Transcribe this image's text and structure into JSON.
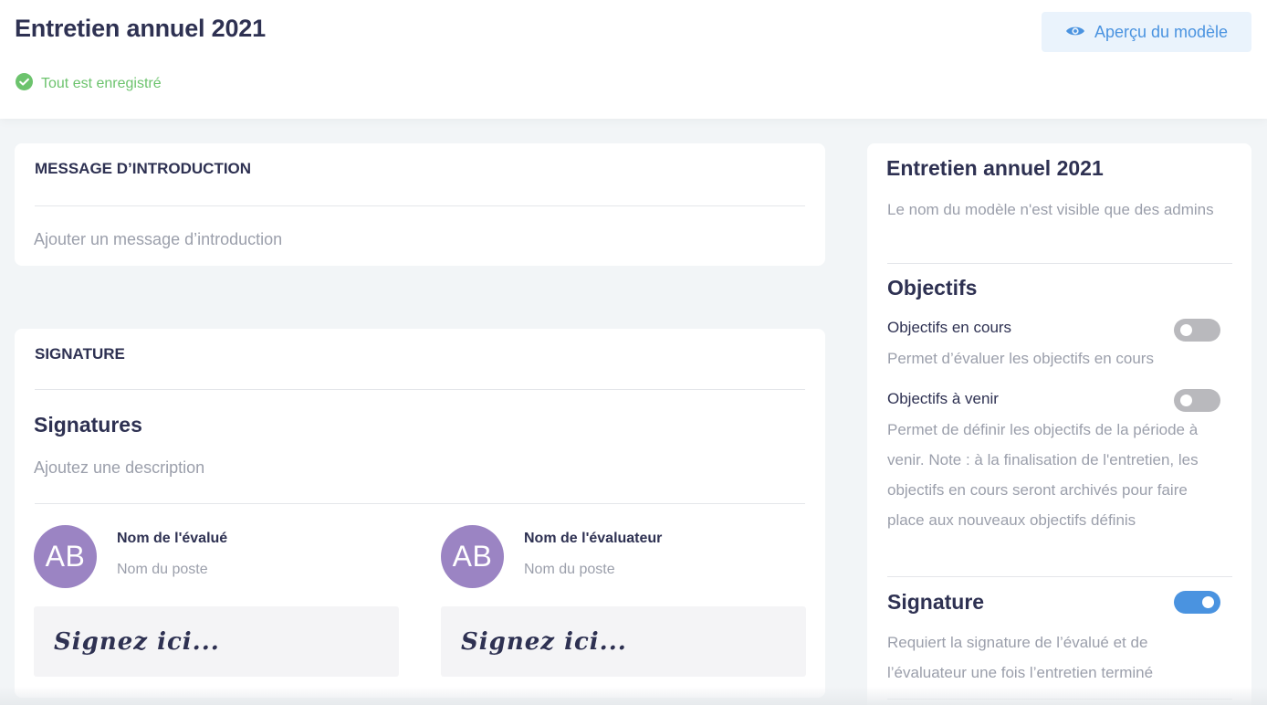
{
  "header": {
    "title": "Entretien annuel 2021",
    "saved_status": "Tout est enregistré",
    "preview_button": "Aperçu du modèle"
  },
  "intro": {
    "heading": "MESSAGE D’INTRODUCTION",
    "placeholder": "Ajouter un message d’introduction"
  },
  "signature": {
    "heading": "SIGNATURE",
    "subtitle": "Signatures",
    "description_placeholder": "Ajoutez une description",
    "evaluee": {
      "initials": "AB",
      "name": "Nom de l'évalué",
      "role": "Nom du poste",
      "sign_placeholder": "Signez ici..."
    },
    "evaluateur": {
      "initials": "AB",
      "name": "Nom de l'évaluateur",
      "role": "Nom du poste",
      "sign_placeholder": "Signez ici..."
    }
  },
  "sidebar": {
    "title": "Entretien annuel 2021",
    "title_note": "Le nom du modèle n'est visible que des admins",
    "objectives": {
      "title": "Objectifs",
      "current": {
        "label": "Objectifs en cours",
        "description": "Permet d’évaluer les objectifs en cours",
        "enabled": false
      },
      "upcoming": {
        "label": "Objectifs à venir",
        "description": "Permet de définir les objectifs de la période à venir. Note : à la finalisation de l'entretien, les objectifs en cours seront archivés pour faire place aux nouveaux objectifs définis",
        "enabled": false
      }
    },
    "signature": {
      "title": "Signature",
      "description": "Requiert la signature de l’évalué et de l’évaluateur une fois l’entretien terminé",
      "enabled": true
    }
  },
  "colors": {
    "accent": "#4a93e0",
    "success": "#6cc36d",
    "avatar": "#9b84c3",
    "text": "#2e3152",
    "muted": "#9b9fab"
  },
  "icons": {
    "saved": "check-circle-icon",
    "preview": "eye-icon"
  }
}
